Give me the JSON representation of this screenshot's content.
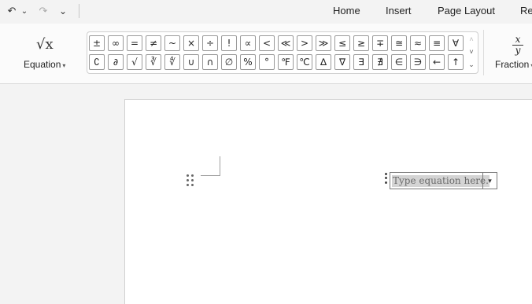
{
  "quick_access": {
    "undo_icon": "undo-icon",
    "redo_icon": "redo-icon",
    "dropdown_glyph": "⌄",
    "customize_glyph": "⌄",
    "undo_glyph": "↶",
    "redo_glyph": "↷"
  },
  "tabs": [
    {
      "label": "Home"
    },
    {
      "label": "Insert"
    },
    {
      "label": "Page Layout"
    },
    {
      "label": "Re"
    }
  ],
  "ribbon": {
    "equation": {
      "label": "Equation",
      "icon_text": "√x"
    },
    "fraction": {
      "label": "Fraction",
      "numerator": "x",
      "denominator": "y"
    },
    "symbols_row1": [
      "±",
      "∞",
      "=",
      "≠",
      "~",
      "×",
      "÷",
      "!",
      "∝",
      "<",
      "≪",
      ">",
      "≫",
      "≤",
      "≥",
      "∓",
      "≅",
      "≈",
      "≡",
      "∀"
    ],
    "symbols_row2": [
      "∁",
      "∂",
      "√",
      "∛",
      "∜",
      "∪",
      "∩",
      "∅",
      "%",
      "°",
      "℉",
      "℃",
      "∆",
      "∇",
      "∃",
      "∄",
      "∈",
      "∋",
      "←",
      "↑"
    ],
    "scroll_up": "˄",
    "scroll_down": "˅",
    "more": "⌄"
  },
  "document": {
    "equation_placeholder": "Type equation here.",
    "equation_dropdown": "▾"
  },
  "colors": {
    "background": "#f3f3f3",
    "ribbon": "#fbfbfb",
    "page": "#ffffff",
    "placeholder_highlight": "#d4d4d4"
  }
}
